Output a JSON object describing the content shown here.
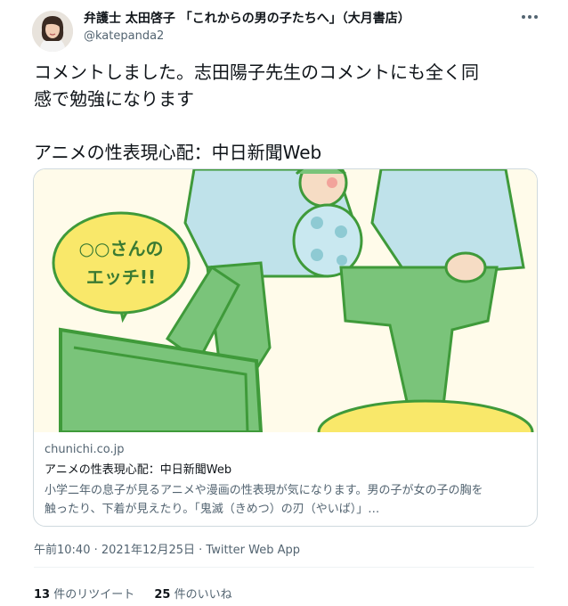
{
  "author": {
    "display_name": "弁護士 太田啓子 「これからの男の子たちへ」（大月書店）",
    "handle": "@katepanda2"
  },
  "tweet": {
    "lines": [
      "コメントしました。志田陽子先生のコメントにも全く同",
      "感で勉強になります",
      "アニメの性表現心配：中日新聞Web"
    ]
  },
  "card": {
    "domain": "chunichi.co.jp",
    "title": "アニメの性表現心配：中日新聞Web",
    "description_lines": [
      "小学二年の息子が見るアニメや漫画の性表現が気になります。男の子が女の子の胸を",
      "触ったり、下着が見えたり。「鬼滅（きめつ）の刃（やいば）」…"
    ],
    "image": {
      "bubble_line1": "○○さんの",
      "bubble_line2": "エッチ!!"
    }
  },
  "meta": {
    "timestamp": "午前10:40 · 2021年12月25日 · Twitter Web App"
  },
  "stats": {
    "retweets_count": "13",
    "retweets_label": "件のリツイート",
    "likes_count": "25",
    "likes_label": "件のいいね"
  },
  "colors": {
    "green_line": "#3f9a3a",
    "green_fill": "#7ac47a",
    "light_blue": "#bfe2ea",
    "yellow": "#f9e86a",
    "cream": "#fffbea"
  }
}
